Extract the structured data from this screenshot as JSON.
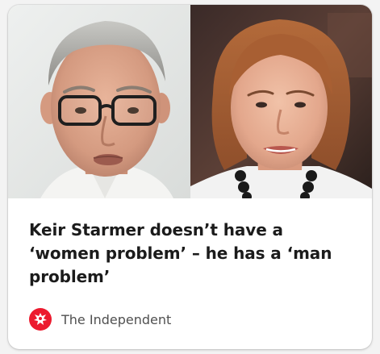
{
  "article": {
    "headline": "Keir Starmer doesn’t have a ‘women problem’ – he has a ‘man problem’",
    "source_name": "The Independent",
    "source_logo_icon": "eagle-icon",
    "images": [
      {
        "subject": "man-portrait"
      },
      {
        "subject": "woman-portrait"
      }
    ]
  },
  "colors": {
    "card_background": "#ffffff",
    "page_background": "#f3f3f3",
    "headline_text": "#1b1b1b",
    "source_text": "#505050",
    "source_logo_red": "#ec1a2e"
  }
}
